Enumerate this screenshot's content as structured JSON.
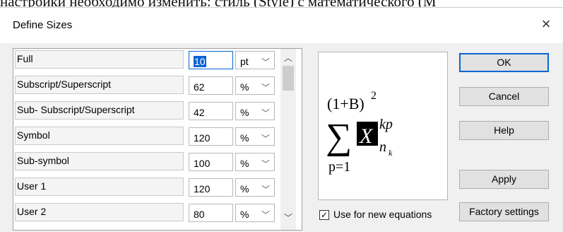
{
  "background_text": "настройки необходимо изменить: стиль (Style) с математического (М",
  "dialog": {
    "title": "Define Sizes",
    "close_label": "×"
  },
  "sizes": [
    {
      "label": "Full",
      "value": "10",
      "unit": "pt",
      "selected": true
    },
    {
      "label": "Subscript/Superscript",
      "value": "62",
      "unit": "%"
    },
    {
      "label": "Sub- Subscript/Superscript",
      "value": "42",
      "unit": "%"
    },
    {
      "label": "Symbol",
      "value": "120",
      "unit": "%"
    },
    {
      "label": "Sub-symbol",
      "value": "100",
      "unit": "%"
    },
    {
      "label": "User 1",
      "value": "120",
      "unit": "%"
    },
    {
      "label": "User 2",
      "value": "80",
      "unit": "%"
    }
  ],
  "icons": {
    "chevron": "chevron-down-icon",
    "scroll_up": "scroll-up-arrow",
    "scroll_down": "scroll-down-arrow"
  },
  "preview": {
    "top_expr": "(1+B)",
    "top_exp": "2",
    "sum_symbol": "∑",
    "highlighted_var": "X",
    "superscript": "kp",
    "subscript_base": "n",
    "subscript_sub": "k",
    "lower_limit": "p=1"
  },
  "use_for_new": {
    "label": "Use for new equations",
    "checked": true
  },
  "buttons": {
    "ok": "OK",
    "cancel": "Cancel",
    "help": "Help",
    "apply": "Apply",
    "factory": "Factory settings"
  }
}
